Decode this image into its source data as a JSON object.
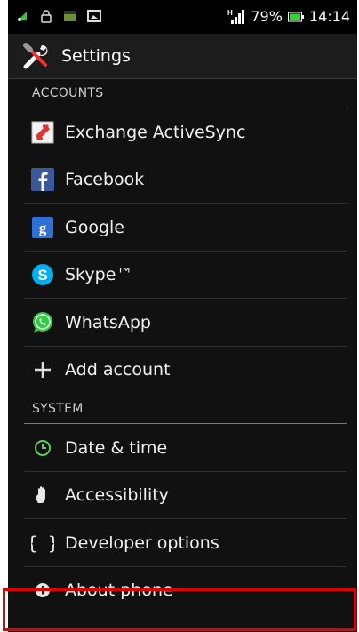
{
  "statusbar": {
    "battery": "79%",
    "time": "14:14",
    "signal_type": "H"
  },
  "actionbar": {
    "title": "Settings"
  },
  "sections": {
    "accounts": "ACCOUNTS",
    "system": "SYSTEM"
  },
  "accounts": [
    {
      "label": "Exchange ActiveSync",
      "icon": "exchange-icon"
    },
    {
      "label": "Facebook",
      "icon": "facebook-icon"
    },
    {
      "label": "Google",
      "icon": "google-icon"
    },
    {
      "label": "Skype™",
      "icon": "skype-icon"
    },
    {
      "label": "WhatsApp",
      "icon": "whatsapp-icon"
    },
    {
      "label": "Add account",
      "icon": "plus-icon"
    }
  ],
  "system": [
    {
      "label": "Date & time",
      "icon": "clock-icon"
    },
    {
      "label": "Accessibility",
      "icon": "hand-icon"
    },
    {
      "label": "Developer options",
      "icon": "braces-icon"
    },
    {
      "label": "About phone",
      "icon": "info-icon"
    }
  ],
  "colors": {
    "highlight": "#e00000",
    "background": "#111111",
    "whatsapp": "#2ecc40",
    "facebook": "#3b5998",
    "google": "#2f6fd8",
    "skype": "#00aff0"
  }
}
